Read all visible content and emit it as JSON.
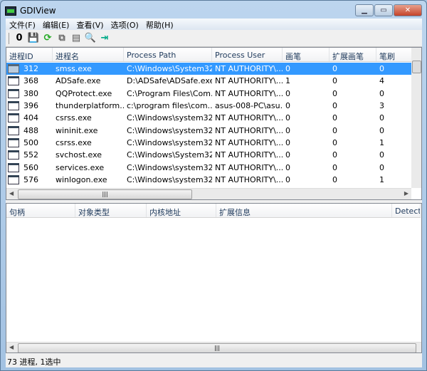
{
  "window": {
    "title": "GDIView"
  },
  "menu": [
    "文件(F)",
    "编辑(E)",
    "查看(V)",
    "选项(O)",
    "帮助(H)"
  ],
  "toolbar": {
    "icons": [
      "zero-icon",
      "save-icon",
      "refresh-icon",
      "copy-icon",
      "properties-icon",
      "find-icon",
      "exit-icon"
    ],
    "zero_label": "0"
  },
  "process_list": {
    "columns": [
      "进程ID",
      "进程名",
      "Process Path",
      "Process User",
      "画笔",
      "扩展画笔",
      "笔刷"
    ],
    "rows": [
      {
        "id": "312",
        "name": "smss.exe",
        "path": "C:\\Windows\\System32...",
        "user": "NT AUTHORITY\\...",
        "pen": "0",
        "extpen": "0",
        "brush": "0",
        "selected": true
      },
      {
        "id": "368",
        "name": "ADSafe.exe",
        "path": "D:\\ADSafe\\ADSafe.exe",
        "user": "NT AUTHORITY\\...",
        "pen": "1",
        "extpen": "0",
        "brush": "4"
      },
      {
        "id": "380",
        "name": "QQProtect.exe",
        "path": "C:\\Program Files\\Com...",
        "user": "NT AUTHORITY\\...",
        "pen": "0",
        "extpen": "0",
        "brush": "0"
      },
      {
        "id": "396",
        "name": "thunderplatform....",
        "path": "c:\\program files\\com...",
        "user": "asus-008-PC\\asu...",
        "pen": "0",
        "extpen": "0",
        "brush": "3"
      },
      {
        "id": "404",
        "name": "csrss.exe",
        "path": "C:\\Windows\\system32...",
        "user": "NT AUTHORITY\\...",
        "pen": "0",
        "extpen": "0",
        "brush": "0"
      },
      {
        "id": "488",
        "name": "wininit.exe",
        "path": "C:\\Windows\\system32...",
        "user": "NT AUTHORITY\\...",
        "pen": "0",
        "extpen": "0",
        "brush": "0"
      },
      {
        "id": "500",
        "name": "csrss.exe",
        "path": "C:\\Windows\\system32...",
        "user": "NT AUTHORITY\\...",
        "pen": "0",
        "extpen": "0",
        "brush": "1"
      },
      {
        "id": "552",
        "name": "svchost.exe",
        "path": "C:\\Windows\\System32...",
        "user": "NT AUTHORITY\\...",
        "pen": "0",
        "extpen": "0",
        "brush": "0"
      },
      {
        "id": "560",
        "name": "services.exe",
        "path": "C:\\Windows\\system32...",
        "user": "NT AUTHORITY\\...",
        "pen": "0",
        "extpen": "0",
        "brush": "0"
      },
      {
        "id": "576",
        "name": "winlogon.exe",
        "path": "C:\\Windows\\system32...",
        "user": "NT AUTHORITY\\...",
        "pen": "0",
        "extpen": "0",
        "brush": "1"
      }
    ]
  },
  "handle_list": {
    "columns": [
      "句柄",
      "对象类型",
      "内核地址",
      "扩展信息",
      "Detect C"
    ]
  },
  "status": "73 进程, 1选中",
  "colors": {
    "selection": "#3399ff"
  }
}
